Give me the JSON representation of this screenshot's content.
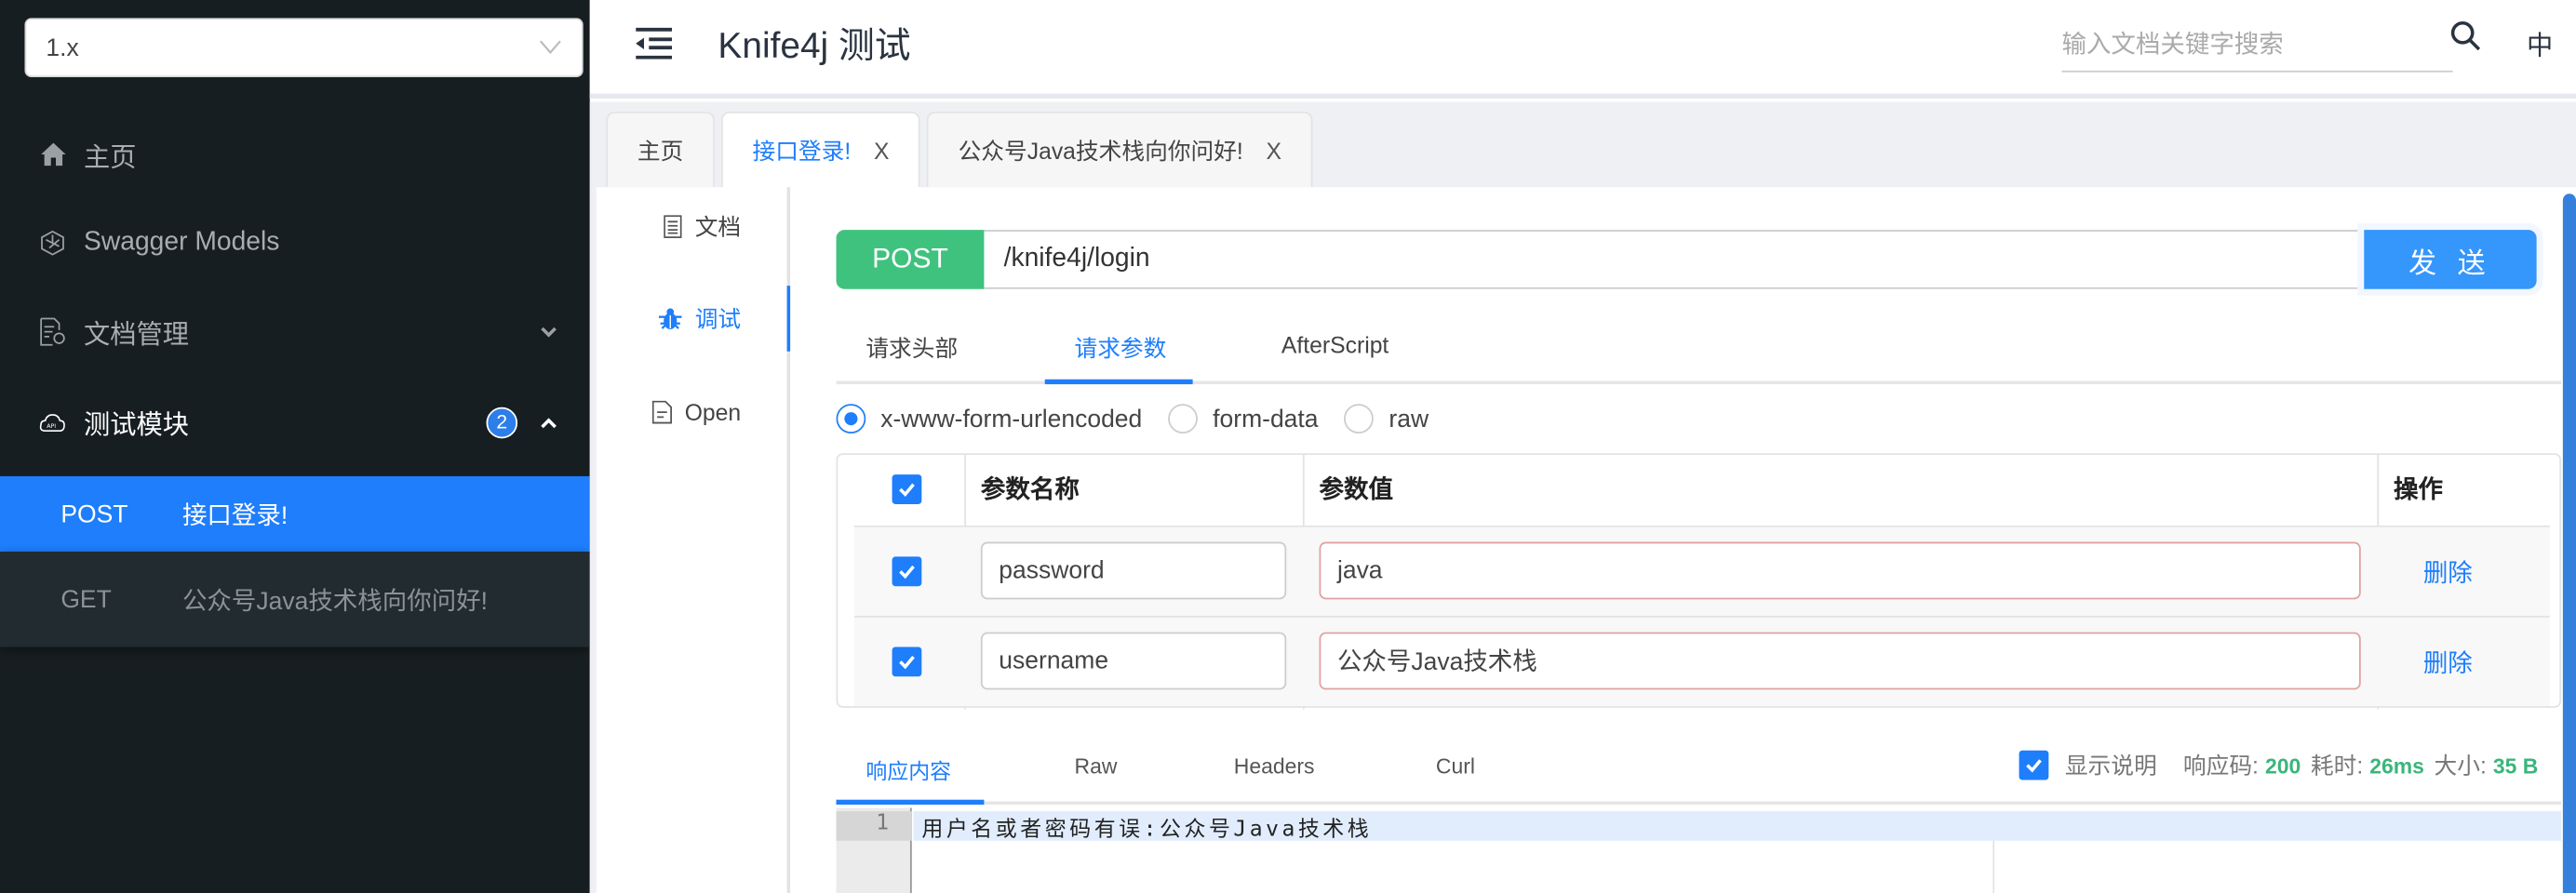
{
  "sidebar": {
    "version": "1.x",
    "items": [
      {
        "label": "主页",
        "icon": "home-icon"
      },
      {
        "label": "Swagger Models",
        "icon": "models-icon"
      },
      {
        "label": "文档管理",
        "icon": "doc-settings-icon"
      },
      {
        "label": "测试模块",
        "icon": "api-cloud-icon",
        "badge": "2"
      }
    ],
    "endpoints": [
      {
        "method": "POST",
        "label": "接口登录!"
      },
      {
        "method": "GET",
        "label": "公众号Java技术栈向你问好!"
      }
    ]
  },
  "header": {
    "title": "Knife4j 测试",
    "search_placeholder": "输入文档关键字搜索",
    "lang": "中"
  },
  "tabs": [
    {
      "label": "主页"
    },
    {
      "label": "接口登录!",
      "close": "X"
    },
    {
      "label": "公众号Java技术栈向你问好!",
      "close": "X"
    }
  ],
  "inner_nav": [
    {
      "label": "文档"
    },
    {
      "label": "调试"
    },
    {
      "label": "Open"
    }
  ],
  "request": {
    "method": "POST",
    "url": "/knife4j/login",
    "send_label": "发 送",
    "tabs": [
      "请求头部",
      "请求参数",
      "AfterScript"
    ],
    "body_types": [
      "x-www-form-urlencoded",
      "form-data",
      "raw"
    ],
    "selected_body_type": "x-www-form-urlencoded",
    "table": {
      "headers": [
        "参数名称",
        "参数值",
        "操作"
      ],
      "rows": [
        {
          "checked": true,
          "name": "password",
          "value": "java",
          "action": "删除"
        },
        {
          "checked": true,
          "name": "username",
          "value": "公众号Java技术栈",
          "action": "删除"
        }
      ]
    }
  },
  "response": {
    "tabs": [
      "响应内容",
      "Raw",
      "Headers",
      "Curl"
    ],
    "show_desc_label": "显示说明",
    "code_label": "响应码:",
    "code": "200",
    "time_label": "耗时:",
    "time": "26ms",
    "size_label": "大小:",
    "size": "35 B",
    "line_number": "1",
    "body": "用户名或者密码有误:公众号Java技术栈"
  }
}
